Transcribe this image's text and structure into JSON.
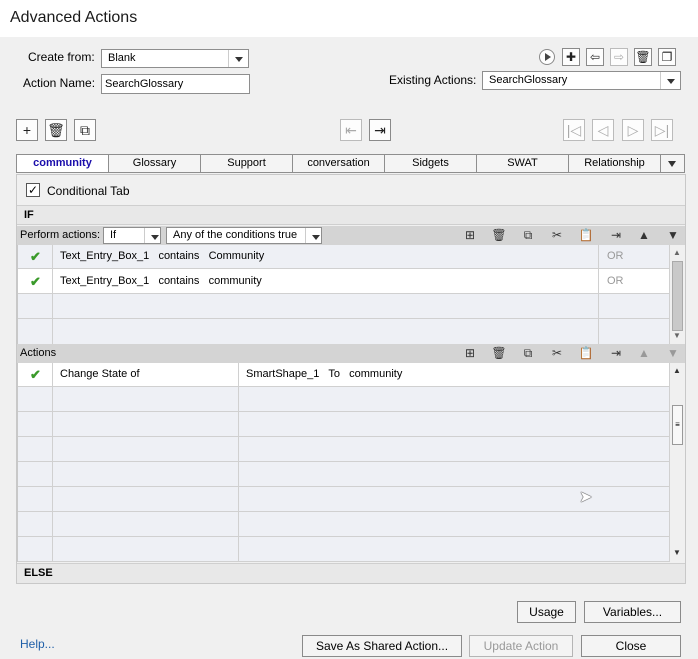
{
  "window": {
    "title": "Advanced Actions"
  },
  "form": {
    "create_from_label": "Create from:",
    "create_from_value": "Blank",
    "action_name_label": "Action Name:",
    "action_name_value": "SearchGlossary",
    "existing_actions_label": "Existing Actions:",
    "existing_actions_value": "SearchGlossary"
  },
  "tabs": [
    "community",
    "Glossary",
    "Support",
    "conversation",
    "Sidgets",
    "SWAT",
    "Relationship"
  ],
  "conditional_tab_label": "Conditional Tab",
  "if_section": {
    "label": "IF",
    "perform_label": "Perform actions:",
    "perform_value": "If",
    "condition_value": "Any of the conditions true",
    "rows": [
      {
        "text": "Text_Entry_Box_1   contains   Community",
        "op": "OR"
      },
      {
        "text": "Text_Entry_Box_1   contains   community",
        "op": "OR"
      }
    ]
  },
  "actions_section": {
    "label": "Actions",
    "rows": [
      {
        "action": "Change State of",
        "target": "SmartShape_1   To   community"
      }
    ]
  },
  "else_label": "ELSE",
  "buttons": {
    "usage": "Usage",
    "variables": "Variables...",
    "help": "Help...",
    "save_shared": "Save As Shared Action...",
    "update": "Update Action",
    "close": "Close"
  },
  "colors": {
    "accent_tab": "#1a0dab",
    "check": "#3a9a2a"
  }
}
